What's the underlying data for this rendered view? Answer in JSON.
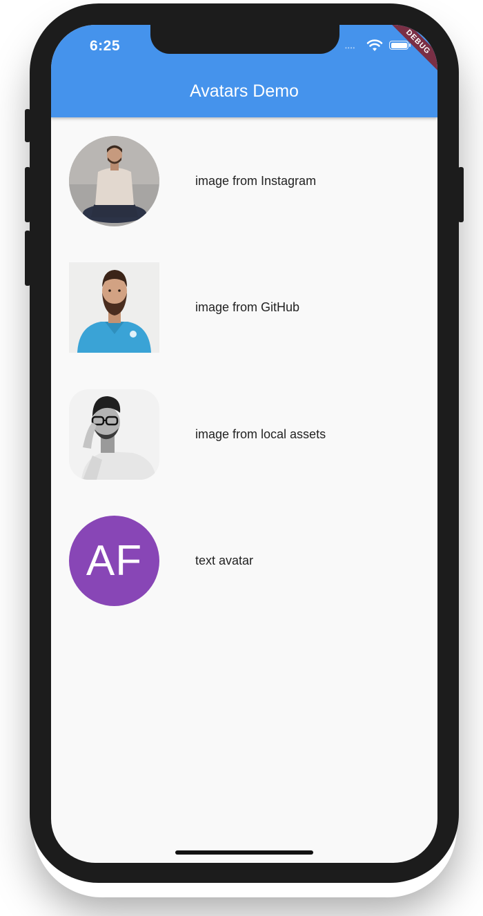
{
  "colors": {
    "appbar": "#4593ec",
    "background": "#f9f9f9",
    "text_avatar_bg": "#8846b6",
    "debug_ribbon": "#7a2f45"
  },
  "status_bar": {
    "time": "6:25",
    "signal": "••••"
  },
  "debug_banner": "DEBUG",
  "app_bar": {
    "title": "Avatars Demo"
  },
  "avatars": [
    {
      "label": "image from Instagram",
      "shape": "circle",
      "icon": "person-photo"
    },
    {
      "label": "image from GitHub",
      "shape": "square",
      "icon": "person-photo"
    },
    {
      "label": "image from local assets",
      "shape": "rounded-square",
      "icon": "person-photo"
    },
    {
      "label": "text avatar",
      "shape": "circle",
      "initials": "AF"
    }
  ]
}
